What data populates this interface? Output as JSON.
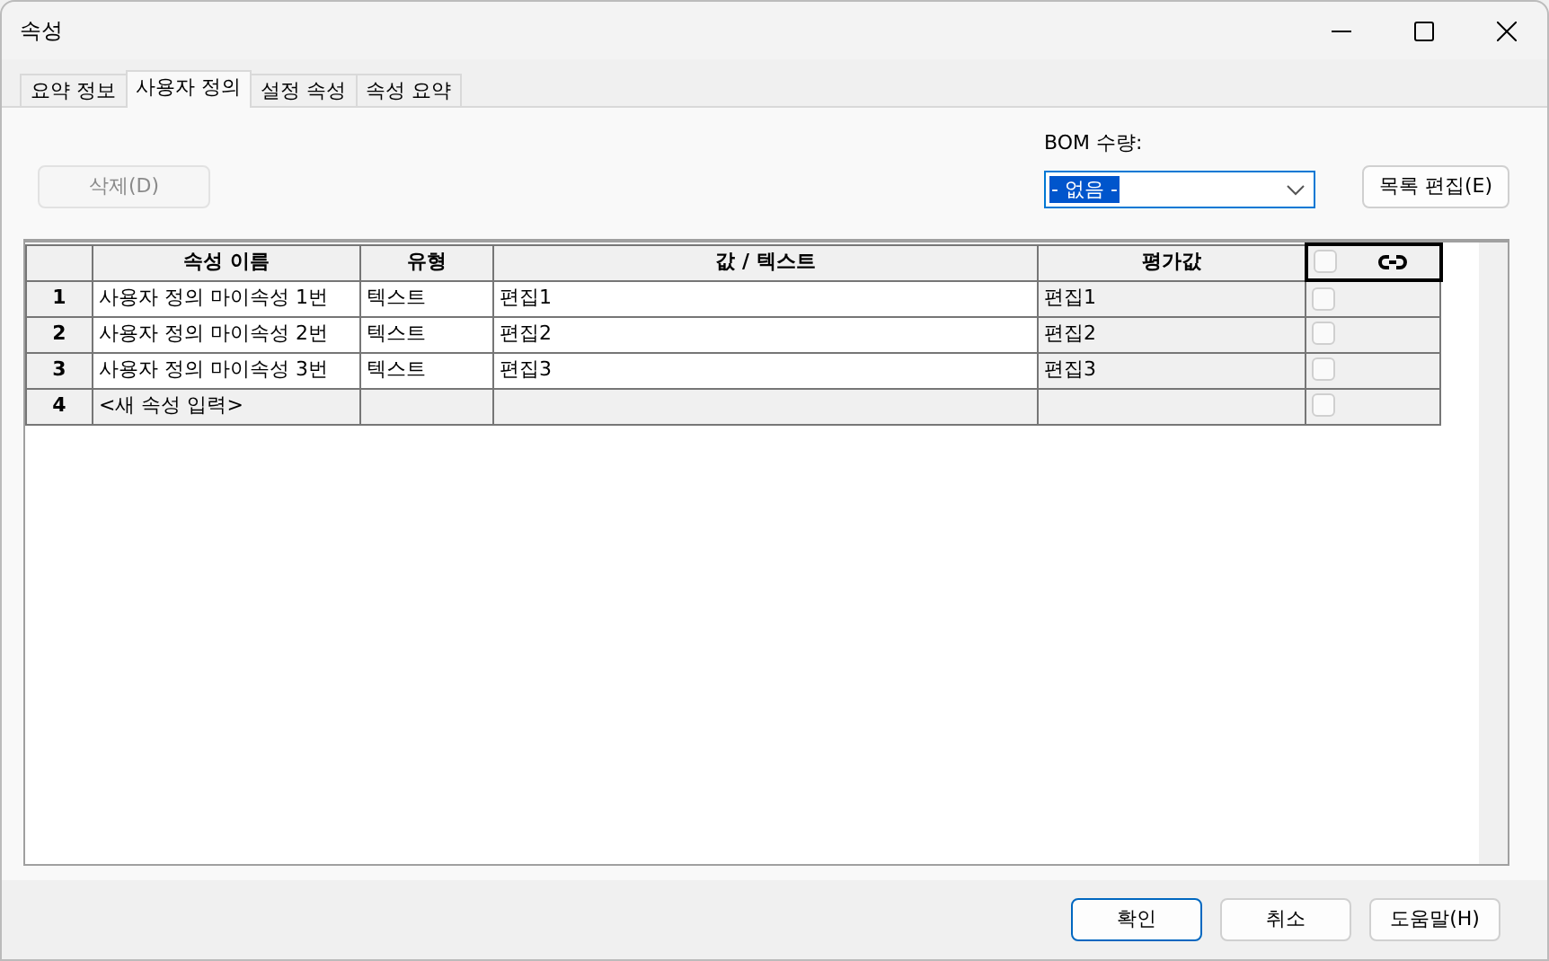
{
  "window": {
    "title": "속성"
  },
  "tabs": [
    {
      "label": "요약 정보",
      "selected": false
    },
    {
      "label": "사용자 정의",
      "selected": true
    },
    {
      "label": "설정 속성",
      "selected": false
    },
    {
      "label": "속성 요약",
      "selected": false
    }
  ],
  "delete_button": {
    "label": "삭제(D)",
    "disabled": true
  },
  "bom_quantity": {
    "label": "BOM 수량:",
    "value": "- 없음 -"
  },
  "list_edit_button": {
    "label": "목록 편집(E)"
  },
  "table": {
    "columns": [
      "속성 이름",
      "유형",
      "값 / 텍스트",
      "평가값"
    ],
    "link_header": {
      "checked": false
    },
    "rows": [
      {
        "number": "1",
        "name": "사용자 정의 마이속성 1번",
        "type": "텍스트",
        "value": "편집1",
        "evaluated": "편집1",
        "checked": false,
        "kind": "property"
      },
      {
        "number": "2",
        "name": "사용자 정의 마이속성 2번",
        "type": "텍스트",
        "value": "편집2",
        "evaluated": "편집2",
        "checked": false,
        "kind": "property"
      },
      {
        "number": "3",
        "name": "사용자 정의 마이속성 3번",
        "type": "텍스트",
        "value": "편집3",
        "evaluated": "편집3",
        "checked": false,
        "kind": "property"
      },
      {
        "number": "4",
        "name": "<새 속성 입력>",
        "checked": false,
        "kind": "new"
      }
    ]
  },
  "buttons": [
    {
      "label": "확인",
      "default": true
    },
    {
      "label": "취소",
      "default": false
    },
    {
      "label": "도움말(H)",
      "default": false
    }
  ]
}
